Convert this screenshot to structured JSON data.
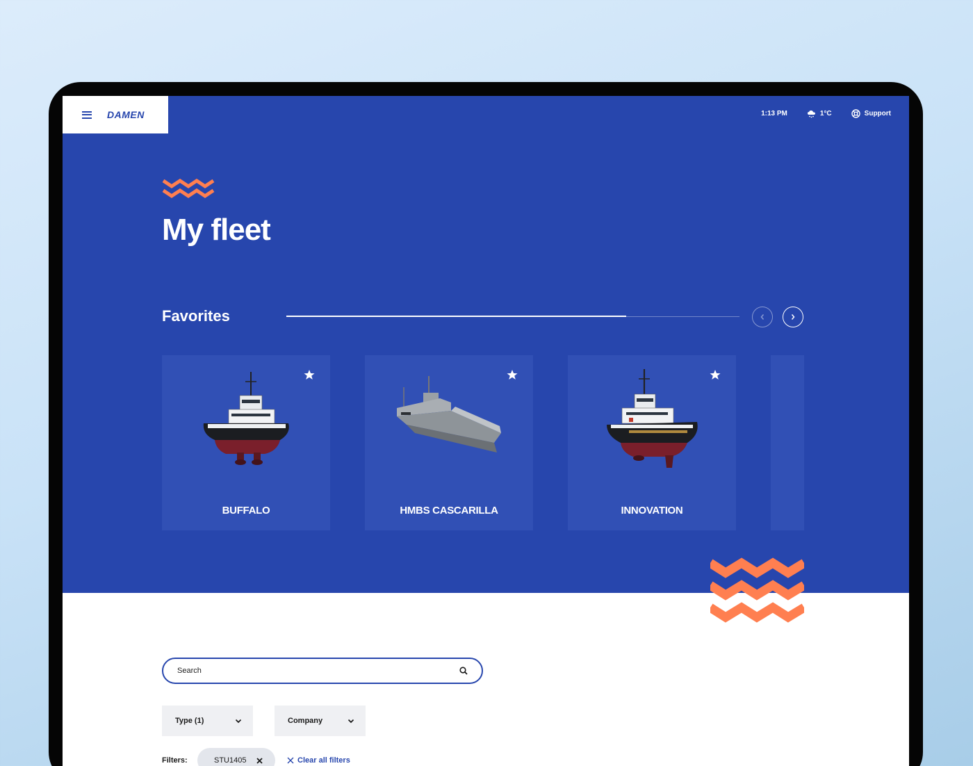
{
  "header": {
    "brand": "DAMEN",
    "time": "1:13 PM",
    "temperature": "1°C",
    "support_label": "Support"
  },
  "hero": {
    "title": "My fleet",
    "favorites_title": "Favorites",
    "carousel_progress": 0.75
  },
  "favorites": [
    {
      "name": "BUFFALO",
      "favorited": true
    },
    {
      "name": "HMBS CASCARILLA",
      "favorited": true
    },
    {
      "name": "INNOVATION",
      "favorited": true
    }
  ],
  "search": {
    "placeholder": "Search"
  },
  "dropdowns": {
    "type_label": "Type (1)",
    "company_label": "Company"
  },
  "filters": {
    "label": "Filters:",
    "active_chip": "STU1405",
    "clear_label": "Clear all filters"
  },
  "colors": {
    "primary": "#2746ad",
    "card": "#3150b5",
    "accent": "#ff7f50"
  },
  "icons": {
    "menu": "hamburger-icon",
    "weather": "cloud-snow-icon",
    "support": "lifebuoy-icon",
    "favorite": "star-icon",
    "prev": "chevron-left-icon",
    "next": "chevron-right-icon",
    "search": "search-icon",
    "dropdown": "chevron-down-icon",
    "remove": "close-icon"
  }
}
